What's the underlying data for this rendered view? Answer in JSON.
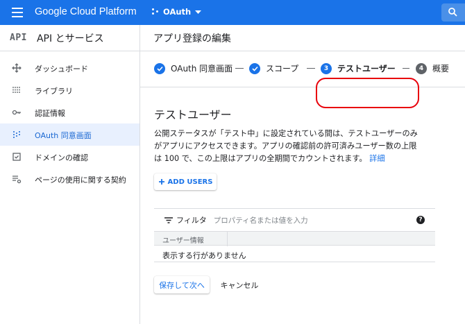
{
  "topbar": {
    "brand": "Google Cloud Platform",
    "project": "OAuth",
    "icons": [
      "menu-icon",
      "project-icon",
      "dropdown-icon",
      "search-icon"
    ]
  },
  "sidebar": {
    "logo": "API",
    "title": "API とサービス",
    "items": [
      {
        "label": "ダッシュボード",
        "icon": "dashboard-icon"
      },
      {
        "label": "ライブラリ",
        "icon": "library-icon"
      },
      {
        "label": "認証情報",
        "icon": "key-icon"
      },
      {
        "label": "OAuth 同意画面",
        "icon": "consent-icon",
        "active": true
      },
      {
        "label": "ドメインの確認",
        "icon": "checkbox-icon"
      },
      {
        "label": "ページの使用に関する契約",
        "icon": "settings-list-icon"
      }
    ]
  },
  "main": {
    "page_title": "アプリ登録の編集",
    "steps": [
      {
        "label": "OAuth 同意画面",
        "state": "done"
      },
      {
        "label": "スコープ",
        "state": "done"
      },
      {
        "label": "テストユーザー",
        "state": "current",
        "number": "3"
      },
      {
        "label": "概要",
        "state": "pending",
        "number": "4"
      }
    ],
    "section_title": "テストユーザー",
    "description_line1": "公開ステータスが「テスト中」に設定されている間は、テストユーザーのみ",
    "description_line2": "がアプリにアクセスできます。アプリの確認前の許可済みユーザー数の上限",
    "description_line3": "は 100 で、この上限はアプリの全期間でカウントされます。",
    "details_link": "詳細",
    "add_users": "ADD USERS",
    "filter_label": "フィルタ",
    "filter_placeholder": "プロパティ名または値を入力",
    "column_header": "ユーザー情報",
    "empty_text": "表示する行がありません",
    "save_button": "保存して次へ",
    "cancel_button": "キャンセル"
  },
  "colors": {
    "accent": "#1a73e8",
    "highlight": "#e8000b"
  }
}
